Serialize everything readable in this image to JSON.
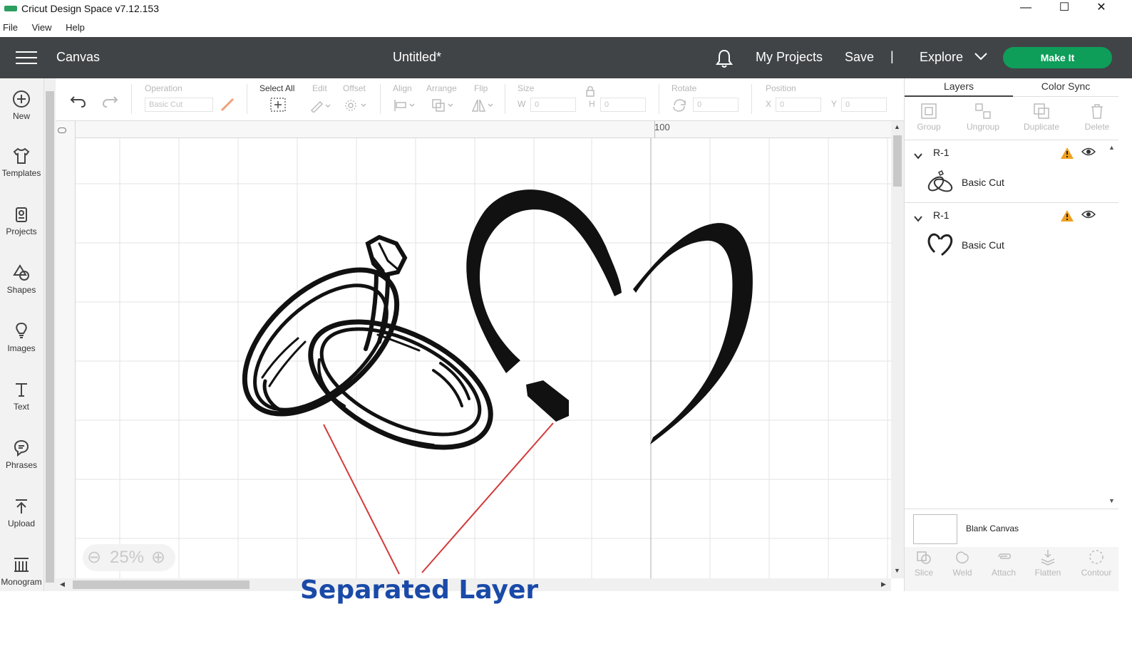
{
  "window": {
    "app_title": "Cricut Design Space  v7.12.153",
    "minimize": "—",
    "maximize": "☐",
    "close": "✕"
  },
  "menu": {
    "items": [
      "File",
      "View",
      "Help"
    ]
  },
  "header": {
    "canvas_label": "Canvas",
    "doc_title": "Untitled*",
    "my_projects": "My Projects",
    "save": "Save",
    "separator": "|",
    "explore": "Explore",
    "make_it": "Make It"
  },
  "leftbar": {
    "items": [
      {
        "label": "New",
        "icon": "plus-circle-icon"
      },
      {
        "label": "Templates",
        "icon": "shirt-icon"
      },
      {
        "label": "Projects",
        "icon": "projects-icon"
      },
      {
        "label": "Shapes",
        "icon": "shapes-icon"
      },
      {
        "label": "Images",
        "icon": "bulb-icon"
      },
      {
        "label": "Text",
        "icon": "text-icon"
      },
      {
        "label": "Phrases",
        "icon": "speech-icon"
      },
      {
        "label": "Upload",
        "icon": "upload-icon"
      },
      {
        "label": "Monogram",
        "icon": "monogram-icon"
      }
    ]
  },
  "toolbar": {
    "operation_label": "Operation",
    "operation_value": "Basic Cut",
    "select_all": "Select All",
    "edit": "Edit",
    "offset": "Offset",
    "align": "Align",
    "arrange": "Arrange",
    "flip": "Flip",
    "size": "Size",
    "w_label": "W",
    "w_value": "0",
    "h_label": "H",
    "h_value": "0",
    "rotate": "Rotate",
    "rotate_value": "0",
    "position": "Position",
    "x_label": "X",
    "x_value": "0",
    "y_label": "Y",
    "y_value": "0"
  },
  "ruler": {
    "mark": "100"
  },
  "zoom": {
    "level": "25%"
  },
  "right_panel": {
    "tabs": [
      "Layers",
      "Color Sync"
    ],
    "actions": [
      "Group",
      "Ungroup",
      "Duplicate",
      "Delete"
    ],
    "layers": [
      {
        "name": "R-1",
        "sub": "Basic Cut",
        "thumb": "rings-thumb"
      },
      {
        "name": "R-1",
        "sub": "Basic Cut",
        "thumb": "heart-thumb"
      }
    ],
    "blank_canvas": "Blank Canvas",
    "bottom_actions": [
      "Slice",
      "Weld",
      "Attach",
      "Flatten",
      "Contour"
    ]
  },
  "annotation": {
    "text": "Separated Layer"
  },
  "colors": {
    "header": "#414447",
    "make_it": "#0e9e5a",
    "annotation": "#1a4aa8",
    "arrow": "#d33b3b",
    "warning": "#f0a020"
  }
}
